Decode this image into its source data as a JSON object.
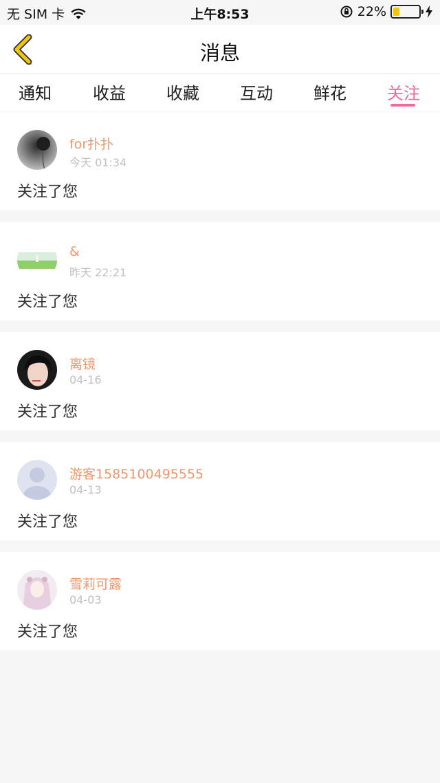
{
  "status_bar": {
    "carrier": "无 SIM 卡",
    "time": "上午8:53",
    "battery": "22%",
    "battery_level": 0.22,
    "icons": [
      "wifi-icon",
      "orientation-lock-icon",
      "battery-icon",
      "charging-bolt-icon"
    ]
  },
  "nav": {
    "back_icon": "chevron-left-icon",
    "title": "消息"
  },
  "tabs": [
    {
      "label": "通知",
      "active": false
    },
    {
      "label": "收益",
      "active": false
    },
    {
      "label": "收藏",
      "active": false
    },
    {
      "label": "互动",
      "active": false
    },
    {
      "label": "鲜花",
      "active": false
    },
    {
      "label": "关注",
      "active": true
    }
  ],
  "messages": [
    {
      "username": "for扑扑",
      "time": "今天 01:34",
      "text": "关注了您",
      "avatar": "avatar-flower-bw"
    },
    {
      "username": "&",
      "time": "昨天 22:21",
      "text": "关注了您",
      "avatar": "avatar-meadow"
    },
    {
      "username": "离镜",
      "time": "04-16",
      "text": "关注了您",
      "avatar": "avatar-portrait"
    },
    {
      "username": "游客1585100495555",
      "time": "04-13",
      "text": "关注了您",
      "avatar": "avatar-default"
    },
    {
      "username": "雪莉可露",
      "time": "04-03",
      "text": "关注了您",
      "avatar": "avatar-illustration"
    }
  ],
  "colors": {
    "accent": "#ee6aa0",
    "username": "#f0966a",
    "back_icon": "#f4c60a",
    "background": "#f7f6f7"
  }
}
